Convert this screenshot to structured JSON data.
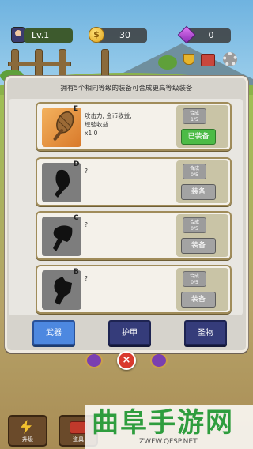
{
  "hud": {
    "level": "Lv.1",
    "coins": "30",
    "gems": "0",
    "coin_icon": "coin-icon",
    "gem_icon": "gem-icon"
  },
  "panel": {
    "header": "拥有5个相同等级的装备可合成更高等级装备",
    "items": [
      {
        "grade": "E",
        "desc": "攻击力, 金币收益,\n经验收益\nx1.0",
        "merge": "合成",
        "merge_count": "1/5",
        "equip": "已装备",
        "unlocked": true
      },
      {
        "grade": "D",
        "desc": "?",
        "merge": "合成",
        "merge_count": "0/5",
        "equip": "装备",
        "unlocked": false
      },
      {
        "grade": "C",
        "desc": "?",
        "merge": "合成",
        "merge_count": "0/5",
        "equip": "装备",
        "unlocked": false
      },
      {
        "grade": "B",
        "desc": "?",
        "merge": "合成",
        "merge_count": "0/5",
        "equip": "装备",
        "unlocked": false
      }
    ],
    "tabs": [
      "武器",
      "护甲",
      "圣物"
    ],
    "active_tab": "武器"
  },
  "close_label": "×",
  "bottom": {
    "upgrade_label": "升级",
    "items_label": "道具"
  },
  "watermark": {
    "title": "曲阜手游网",
    "url": "ZWFW.QFSP.NET"
  },
  "colors": {
    "equipped_button": "#4cbb46",
    "tab_active": "#4d88e0",
    "tab_inactive": "#353c7a",
    "close_button": "#d93a2e"
  }
}
